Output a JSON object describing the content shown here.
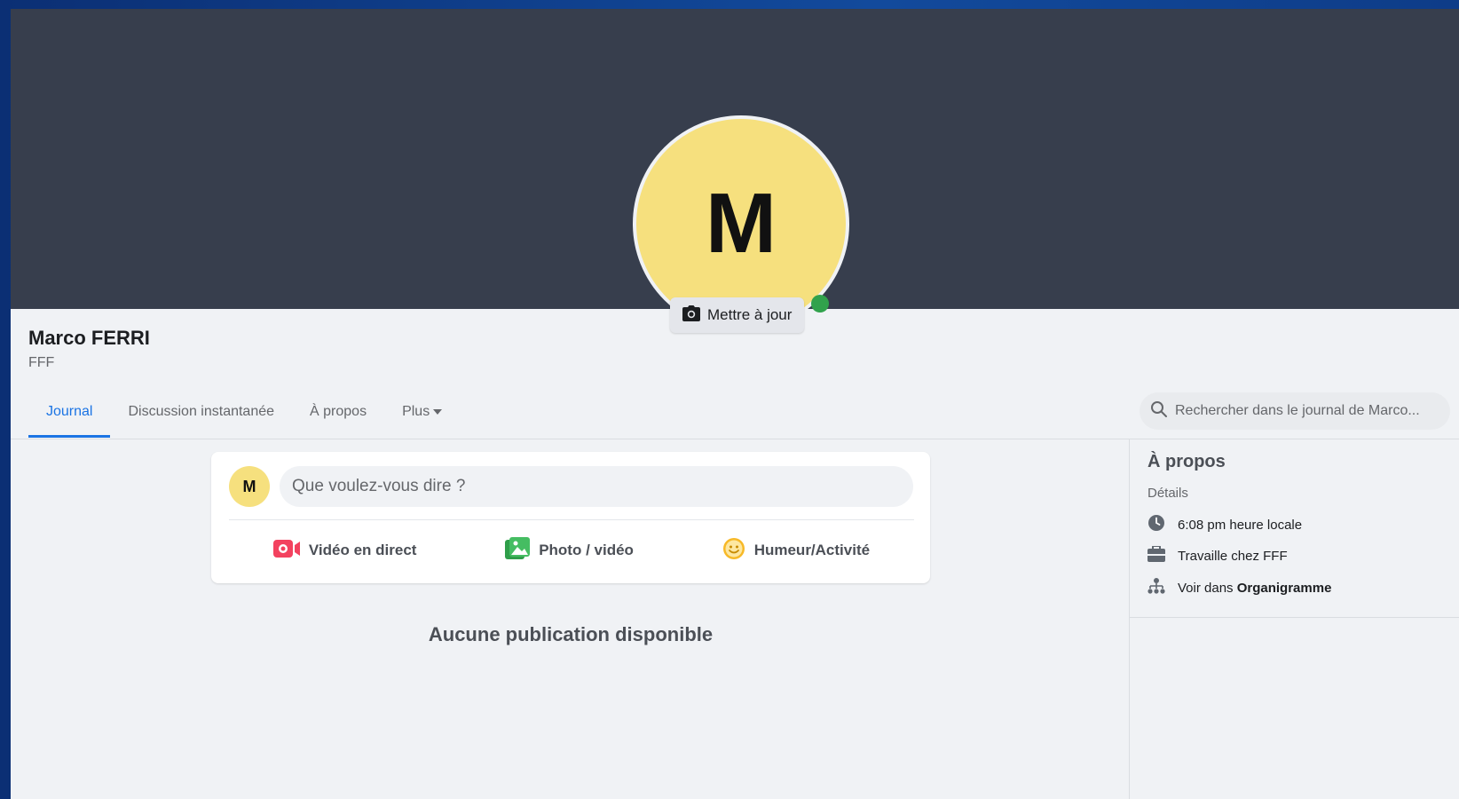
{
  "profile": {
    "initial": "M",
    "name": "Marco FERRI",
    "subtitle": "FFF",
    "update_label": "Mettre à jour"
  },
  "tabs": [
    {
      "label": "Journal",
      "active": true
    },
    {
      "label": "Discussion instantanée",
      "active": false
    },
    {
      "label": "À propos",
      "active": false
    },
    {
      "label": "Plus",
      "active": false
    }
  ],
  "search": {
    "placeholder": "Rechercher dans le journal de Marco..."
  },
  "composer": {
    "avatar_initial": "M",
    "placeholder": "Que voulez-vous dire ?",
    "actions": [
      {
        "label": "Vidéo en direct",
        "icon": "live-video-icon",
        "color": "#f3425f"
      },
      {
        "label": "Photo / vidéo",
        "icon": "photo-icon",
        "color": "#45bd62"
      },
      {
        "label": "Humeur/Activité",
        "icon": "smiley-icon",
        "color": "#f7b928"
      }
    ]
  },
  "feed": {
    "empty_text": "Aucune publication disponible"
  },
  "about": {
    "title": "À propos",
    "subtitle": "Détails",
    "local_time": "6:08 pm heure locale",
    "work": "Travaille chez FFF",
    "org_prefix": "Voir dans ",
    "org_link": "Organigramme"
  },
  "colors": {
    "accent": "#1b74e4",
    "cover": "#373e4d",
    "avatar": "#f6e07e",
    "online": "#31a24c"
  }
}
